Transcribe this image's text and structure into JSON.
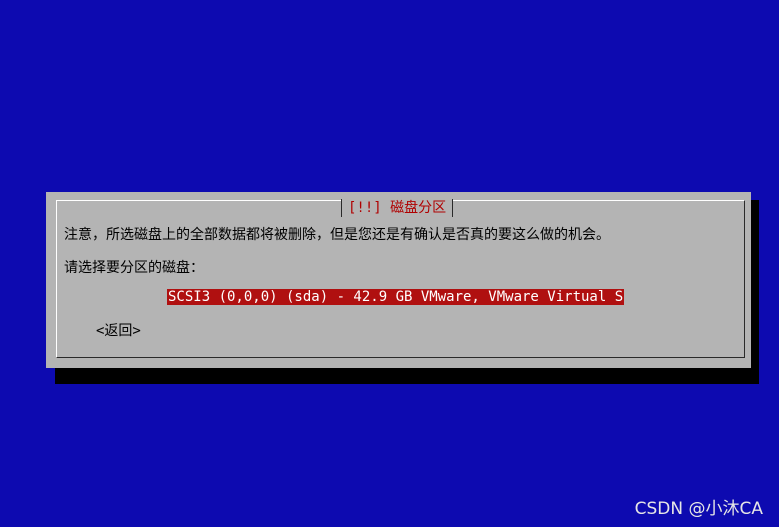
{
  "dialog": {
    "title": "[!!] 磁盘分区",
    "notice": "注意，所选磁盘上的全部数据都将被删除，但是您还是有确认是否真的要这么做的机会。",
    "prompt": "请选择要分区的磁盘：",
    "options": [
      "SCSI3 (0,0,0) (sda) - 42.9 GB VMware, VMware Virtual S"
    ],
    "back_label": "<返回>"
  },
  "watermark": "CSDN @小沐CA",
  "colors": {
    "background": "#0d0ab0",
    "dialog": "#b4b4b4",
    "title_text": "#b00000",
    "selection": "#b01010"
  }
}
